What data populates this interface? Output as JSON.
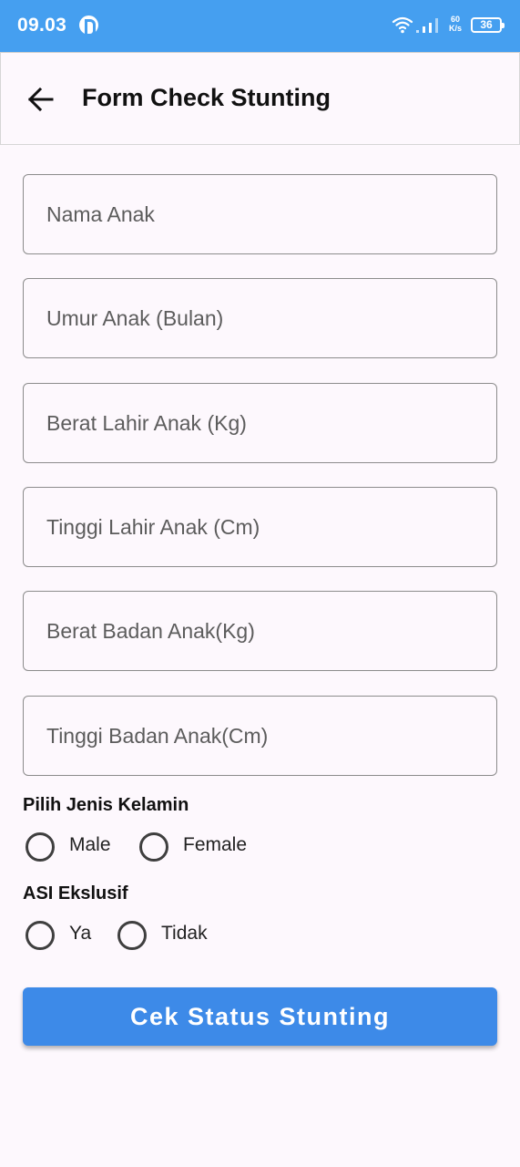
{
  "status_bar": {
    "time": "09.03",
    "netspeed_value": "60",
    "netspeed_unit": "K/s",
    "battery": "36"
  },
  "app_bar": {
    "title": "Form Check Stunting"
  },
  "form": {
    "fields": [
      {
        "placeholder": "Nama Anak",
        "value": ""
      },
      {
        "placeholder": "Umur Anak (Bulan)",
        "value": ""
      },
      {
        "placeholder": "Berat Lahir Anak (Kg)",
        "value": ""
      },
      {
        "placeholder": "Tinggi Lahir Anak (Cm)",
        "value": ""
      },
      {
        "placeholder": "Berat Badan Anak(Kg)",
        "value": ""
      },
      {
        "placeholder": "Tinggi Badan Anak(Cm)",
        "value": ""
      }
    ],
    "gender": {
      "label": "Pilih Jenis Kelamin",
      "options": [
        "Male",
        "Female"
      ]
    },
    "asi": {
      "label": "ASI Ekslusif",
      "options": [
        "Ya",
        "Tidak"
      ]
    },
    "submit_label": "Cek Status Stunting"
  },
  "colors": {
    "status_bar": "#459ff0",
    "button": "#3d8ae8",
    "background": "#fdf8fd"
  }
}
